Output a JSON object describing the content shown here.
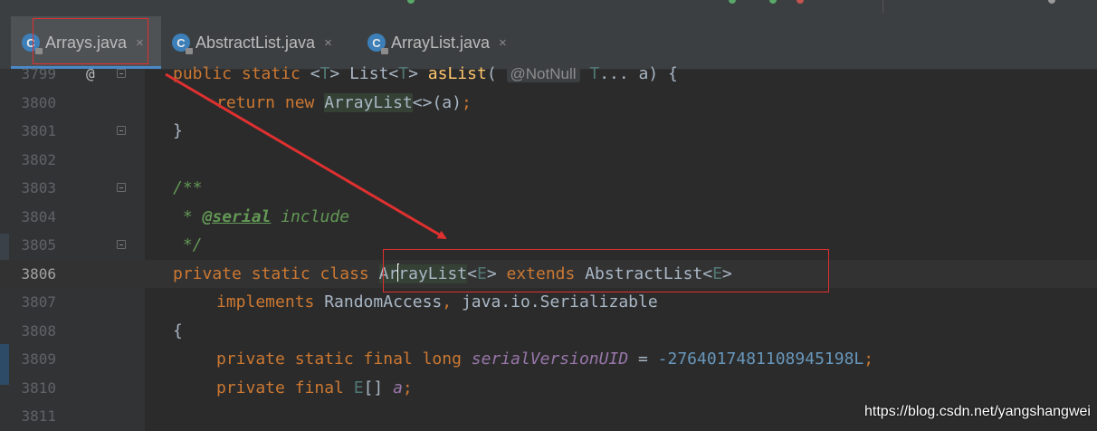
{
  "tabs": [
    {
      "label": "Arrays.java",
      "icon": "C",
      "active": true
    },
    {
      "label": "AbstractList.java",
      "icon": "C",
      "active": false
    },
    {
      "label": "ArrayList.java",
      "icon": "C",
      "active": false
    }
  ],
  "tab_close_glyph": "×",
  "annotation_marker": "@",
  "lines": {
    "l3799": {
      "num": "3799",
      "kw1": "public static ",
      "t1": "<",
      "tt1": "T",
      "t2": "> List<",
      "tt2": "T",
      "t3": "> ",
      "fn": "asList",
      "t4": "( ",
      "hint": "@NotNull",
      "t5": " ",
      "tt3": "T",
      "t6": "... a) {"
    },
    "l3800": {
      "num": "3800",
      "kw": "return new ",
      "hl": "ArrayList",
      "rest": "<>(a)",
      "semi": ";"
    },
    "l3801": {
      "num": "3801",
      "text": "}"
    },
    "l3802": {
      "num": "3802"
    },
    "l3803": {
      "num": "3803",
      "cm": "/**"
    },
    "l3804": {
      "num": "3804",
      "cm1": " * ",
      "tag": "@serial",
      "cm2": " include"
    },
    "l3805": {
      "num": "3805",
      "cm": " */"
    },
    "l3806": {
      "num": "3806",
      "kw1": "private static class ",
      "n1": "Ar",
      "n2": "rayList",
      "t1": "<",
      "e1": "E",
      "t2": "> ",
      "kw2": "extends",
      "t3": " AbstractList<",
      "e2": "E",
      "t4": ">"
    },
    "l3807": {
      "num": "3807",
      "kw": "implements",
      "t1": " RandomAccess",
      "comma": ",",
      "t2": " java.io.Serializable"
    },
    "l3808": {
      "num": "3808",
      "text": "{"
    },
    "l3809": {
      "num": "3809",
      "kw": "private static final long ",
      "fld": "serialVersionUID",
      "eq": " = ",
      "num_val": "-2764017481108945198L",
      "semi": ";"
    },
    "l3810": {
      "num": "3810",
      "kw": "private final ",
      "e": "E",
      "t1": "[] ",
      "fld": "a",
      "semi": ";"
    },
    "l3811": {
      "num": "3811"
    }
  },
  "watermark": "https://blog.csdn.net/yangshangwei",
  "colors": {
    "annotation_box": "#e03030",
    "arrow": "#e03030",
    "active_tab_underline": "#4a88c7"
  }
}
